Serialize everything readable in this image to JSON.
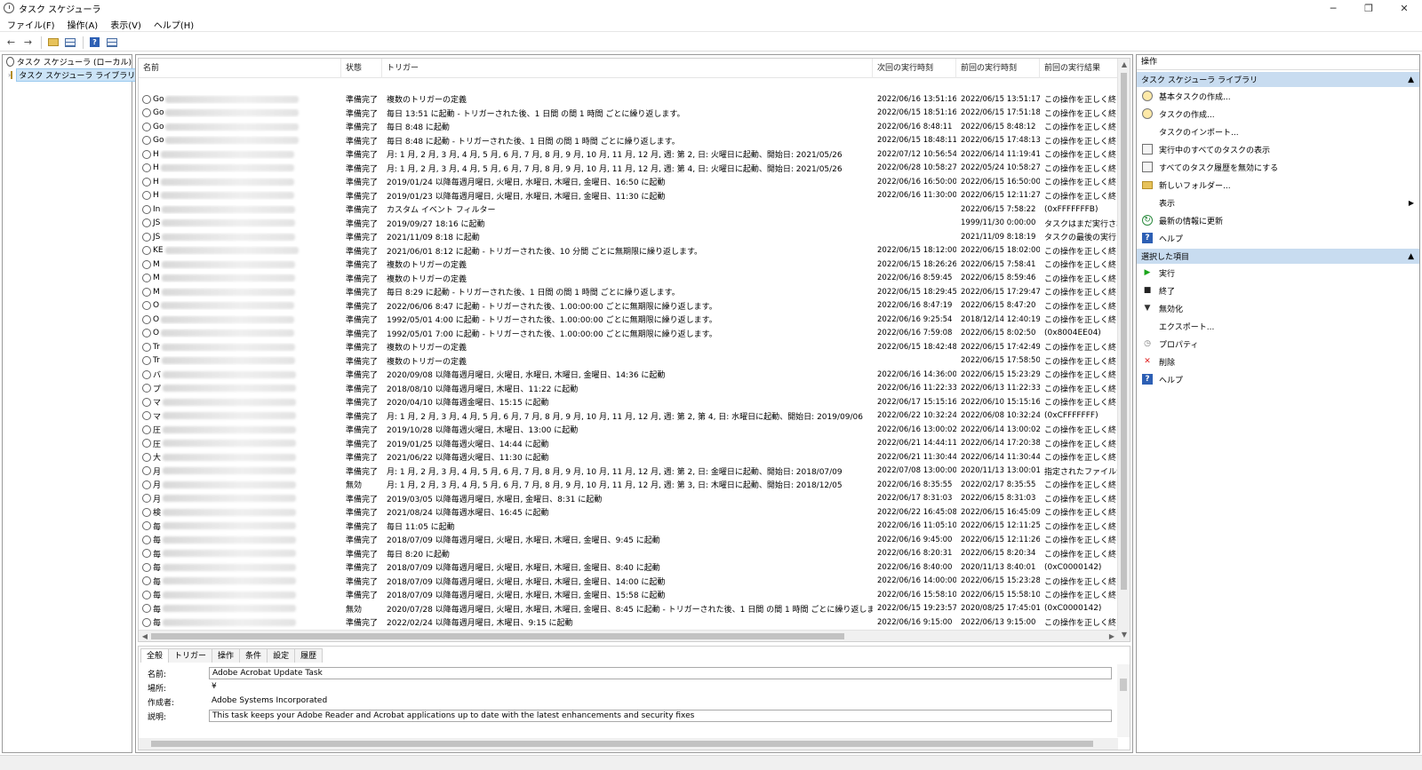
{
  "window": {
    "title": "タスク スケジューラ",
    "controls": [
      "─",
      "❐",
      "✕"
    ]
  },
  "menu": [
    "ファイル(F)",
    "操作(A)",
    "表示(V)",
    "ヘルプ(H)"
  ],
  "toolbar": {
    "back": "←",
    "forward": "→",
    "help": "?"
  },
  "tree": {
    "root_label": "タスク スケジューラ (ローカル)",
    "library_label": "タスク スケジューラ ライブラリ",
    "expander": "›"
  },
  "columns": [
    "名前",
    "状態",
    "トリガー",
    "次回の実行時刻",
    "前回の実行時刻",
    "前回の実行結果"
  ],
  "tasks": [
    {
      "name": "Go",
      "status": "準備完了",
      "trigger": "複数のトリガーの定義",
      "next": "2022/06/16 13:51:16",
      "last": "2022/06/15 13:51:17",
      "result": "この操作を正しく終了"
    },
    {
      "name": "Go",
      "status": "準備完了",
      "trigger": "毎日 13:51 に起動 - トリガーされた後、1 日間 の間 1 時間 ごとに繰り返します。",
      "next": "2022/06/15 18:51:16",
      "last": "2022/06/15 17:51:18",
      "result": "この操作を正しく終了"
    },
    {
      "name": "Go",
      "status": "準備完了",
      "trigger": "毎日 8:48 に起動",
      "next": "2022/06/16 8:48:11",
      "last": "2022/06/15 8:48:12",
      "result": "この操作を正しく終了"
    },
    {
      "name": "Go",
      "status": "準備完了",
      "trigger": "毎日 8:48 に起動 - トリガーされた後、1 日間 の間 1 時間 ごとに繰り返します。",
      "next": "2022/06/15 18:48:11",
      "last": "2022/06/15 17:48:13",
      "result": "この操作を正しく終了"
    },
    {
      "name": "H",
      "status": "準備完了",
      "trigger": "月: 1 月, 2 月, 3 月, 4 月, 5 月, 6 月, 7 月, 8 月, 9 月, 10 月, 11 月, 12 月, 週: 第 2, 日: 火曜日に起動、開始日: 2021/05/26",
      "next": "2022/07/12 10:56:54",
      "last": "2022/06/14 11:19:41",
      "result": "この操作を正しく終了"
    },
    {
      "name": "H",
      "status": "準備完了",
      "trigger": "月: 1 月, 2 月, 3 月, 4 月, 5 月, 6 月, 7 月, 8 月, 9 月, 10 月, 11 月, 12 月, 週: 第 4, 日: 火曜日に起動、開始日: 2021/05/26",
      "next": "2022/06/28 10:58:27",
      "last": "2022/05/24 10:58:27",
      "result": "この操作を正しく終了"
    },
    {
      "name": "H",
      "status": "準備完了",
      "trigger": "2019/01/24 以降毎週月曜日, 火曜日, 水曜日, 木曜日, 金曜日、16:50 に起動",
      "next": "2022/06/16 16:50:00",
      "last": "2022/06/15 16:50:00",
      "result": "この操作を正しく終了"
    },
    {
      "name": "H",
      "status": "準備完了",
      "trigger": "2019/01/23 以降毎週月曜日, 火曜日, 水曜日, 木曜日, 金曜日、11:30 に起動",
      "next": "2022/06/16 11:30:00",
      "last": "2022/06/15 12:11:27",
      "result": "この操作を正しく終了"
    },
    {
      "name": "In",
      "status": "準備完了",
      "trigger": "カスタム イベント フィルター",
      "next": "",
      "last": "2022/06/15 7:58:22",
      "result": "(0xFFFFFFFB)"
    },
    {
      "name": "JS",
      "status": "準備完了",
      "trigger": "2019/09/27 18:16 に起動",
      "next": "",
      "last": "1999/11/30 0:00:00",
      "result": "タスクはまだ実行されていません"
    },
    {
      "name": "JS",
      "status": "準備完了",
      "trigger": "2021/11/09 8:18 に起動",
      "next": "",
      "last": "2021/11/09 8:18:19",
      "result": "タスクの最後の実行"
    },
    {
      "name": "KE",
      "status": "準備完了",
      "trigger": "2021/06/01 8:12 に起動 - トリガーされた後、10 分間 ごとに無期限に繰り返します。",
      "next": "2022/06/15 18:12:00",
      "last": "2022/06/15 18:02:00",
      "result": "この操作を正しく終了"
    },
    {
      "name": "M",
      "status": "準備完了",
      "trigger": "複数のトリガーの定義",
      "next": "2022/06/15 18:26:26",
      "last": "2022/06/15 7:58:41",
      "result": "この操作を正しく終了"
    },
    {
      "name": "M",
      "status": "準備完了",
      "trigger": "複数のトリガーの定義",
      "next": "2022/06/16 8:59:45",
      "last": "2022/06/15 8:59:46",
      "result": "この操作を正しく終了"
    },
    {
      "name": "M",
      "status": "準備完了",
      "trigger": "毎日 8:29 に起動 - トリガーされた後、1 日間 の間 1 時間 ごとに繰り返します。",
      "next": "2022/06/15 18:29:45",
      "last": "2022/06/15 17:29:47",
      "result": "この操作を正しく終了"
    },
    {
      "name": "O",
      "status": "準備完了",
      "trigger": "2022/06/06 8:47 に起動 - トリガーされた後、1.00:00:00 ごとに無期限に繰り返します。",
      "next": "2022/06/16 8:47:19",
      "last": "2022/06/15 8:47:20",
      "result": "この操作を正しく終了"
    },
    {
      "name": "O",
      "status": "準備完了",
      "trigger": "1992/05/01 4:00 に起動 - トリガーされた後、1.00:00:00 ごとに無期限に繰り返します。",
      "next": "2022/06/16 9:25:54",
      "last": "2018/12/14 12:40:19",
      "result": "この操作を正しく終了"
    },
    {
      "name": "O",
      "status": "準備完了",
      "trigger": "1992/05/01 7:00 に起動 - トリガーされた後、1.00:00:00 ごとに無期限に繰り返します。",
      "next": "2022/06/16 7:59:08",
      "last": "2022/06/15 8:02:50",
      "result": "(0x8004EE04)"
    },
    {
      "name": "Tr",
      "status": "準備完了",
      "trigger": "複数のトリガーの定義",
      "next": "2022/06/15 18:42:48",
      "last": "2022/06/15 17:42:49",
      "result": "この操作を正しく終了"
    },
    {
      "name": "Tr",
      "status": "準備完了",
      "trigger": "複数のトリガーの定義",
      "next": "",
      "last": "2022/06/15 17:58:50",
      "result": "この操作を正しく終了"
    },
    {
      "name": "バ",
      "status": "準備完了",
      "trigger": "2020/09/08 以降毎週月曜日, 火曜日, 水曜日, 木曜日, 金曜日、14:36 に起動",
      "next": "2022/06/16 14:36:00",
      "last": "2022/06/15 15:23:29",
      "result": "この操作を正しく終了"
    },
    {
      "name": "プ",
      "status": "準備完了",
      "trigger": "2018/08/10 以降毎週月曜日, 木曜日、11:22 に起動",
      "next": "2022/06/16 11:22:33",
      "last": "2022/06/13 11:22:33",
      "result": "この操作を正しく終了"
    },
    {
      "name": "マ",
      "status": "準備完了",
      "trigger": "2020/04/10 以降毎週金曜日、15:15 に起動",
      "next": "2022/06/17 15:15:16",
      "last": "2022/06/10 15:15:16",
      "result": "この操作を正しく終了"
    },
    {
      "name": "マ",
      "status": "準備完了",
      "trigger": "月: 1 月, 2 月, 3 月, 4 月, 5 月, 6 月, 7 月, 8 月, 9 月, 10 月, 11 月, 12 月, 週: 第 2, 第 4, 日: 水曜日に起動、開始日: 2019/09/06",
      "next": "2022/06/22 10:32:24",
      "last": "2022/06/08 10:32:24",
      "result": "(0xCFFFFFFF)"
    },
    {
      "name": "圧",
      "status": "準備完了",
      "trigger": "2019/10/28 以降毎週火曜日, 木曜日、13:00 に起動",
      "next": "2022/06/16 13:00:02",
      "last": "2022/06/14 13:00:02",
      "result": "この操作を正しく終了"
    },
    {
      "name": "圧",
      "status": "準備完了",
      "trigger": "2019/01/25 以降毎週火曜日、14:44 に起動",
      "next": "2022/06/21 14:44:11",
      "last": "2022/06/14 17:20:38",
      "result": "この操作を正しく終了"
    },
    {
      "name": "大",
      "status": "準備完了",
      "trigger": "2021/06/22 以降毎週火曜日、11:30 に起動",
      "next": "2022/06/21 11:30:44",
      "last": "2022/06/14 11:30:44",
      "result": "この操作を正しく終了"
    },
    {
      "name": "月",
      "status": "準備完了",
      "trigger": "月: 1 月, 2 月, 3 月, 4 月, 5 月, 6 月, 7 月, 8 月, 9 月, 10 月, 11 月, 12 月, 週: 第 2, 日: 金曜日に起動、開始日: 2018/07/09",
      "next": "2022/07/08 13:00:00",
      "last": "2020/11/13 13:00:01",
      "result": "指定されたファイルが見つかりません"
    },
    {
      "name": "月",
      "status": "無効",
      "trigger": "月: 1 月, 2 月, 3 月, 4 月, 5 月, 6 月, 7 月, 8 月, 9 月, 10 月, 11 月, 12 月, 週: 第 3, 日: 木曜日に起動、開始日: 2018/12/05",
      "next": "2022/06/16 8:35:55",
      "last": "2022/02/17 8:35:55",
      "result": "この操作を正しく終了"
    },
    {
      "name": "月",
      "status": "準備完了",
      "trigger": "2019/03/05 以降毎週月曜日, 水曜日, 金曜日、8:31 に起動",
      "next": "2022/06/17 8:31:03",
      "last": "2022/06/15 8:31:03",
      "result": "この操作を正しく終了"
    },
    {
      "name": "検",
      "status": "準備完了",
      "trigger": "2021/08/24 以降毎週水曜日、16:45 に起動",
      "next": "2022/06/22 16:45:08",
      "last": "2022/06/15 16:45:09",
      "result": "この操作を正しく終了"
    },
    {
      "name": "毎",
      "status": "準備完了",
      "trigger": "毎日 11:05 に起動",
      "next": "2022/06/16 11:05:10",
      "last": "2022/06/15 12:11:25",
      "result": "この操作を正しく終了"
    },
    {
      "name": "毎",
      "status": "準備完了",
      "trigger": "2018/07/09 以降毎週月曜日, 火曜日, 水曜日, 木曜日, 金曜日、9:45 に起動",
      "next": "2022/06/16 9:45:00",
      "last": "2022/06/15 12:11:26",
      "result": "この操作を正しく終了"
    },
    {
      "name": "毎",
      "status": "準備完了",
      "trigger": "毎日 8:20 に起動",
      "next": "2022/06/16 8:20:31",
      "last": "2022/06/15 8:20:34",
      "result": "この操作を正しく終了"
    },
    {
      "name": "毎",
      "status": "準備完了",
      "trigger": "2018/07/09 以降毎週月曜日, 火曜日, 水曜日, 木曜日, 金曜日、8:40 に起動",
      "next": "2022/06/16 8:40:00",
      "last": "2020/11/13 8:40:01",
      "result": "(0xC0000142)"
    },
    {
      "name": "毎",
      "status": "準備完了",
      "trigger": "2018/07/09 以降毎週月曜日, 火曜日, 水曜日, 木曜日, 金曜日、14:00 に起動",
      "next": "2022/06/16 14:00:00",
      "last": "2022/06/15 15:23:28",
      "result": "この操作を正しく終了"
    },
    {
      "name": "毎",
      "status": "準備完了",
      "trigger": "2018/07/09 以降毎週月曜日, 火曜日, 水曜日, 木曜日, 金曜日、15:58 に起動",
      "next": "2022/06/16 15:58:10",
      "last": "2022/06/15 15:58:10",
      "result": "この操作を正しく終了"
    },
    {
      "name": "毎",
      "status": "無効",
      "trigger": "2020/07/28 以降毎週月曜日, 火曜日, 水曜日, 木曜日, 金曜日、8:45 に起動 - トリガーされた後、1 日間 の間 1 時間 ごとに繰り返します。",
      "next": "2022/06/15 19:23:57",
      "last": "2020/08/25 17:45:01",
      "result": "(0xC0000142)"
    },
    {
      "name": "毎",
      "status": "準備完了",
      "trigger": "2022/02/24 以降毎週月曜日, 木曜日、9:15 に起動",
      "next": "2022/06/16 9:15:00",
      "last": "2022/06/13 9:15:00",
      "result": "この操作を正しく終了"
    }
  ],
  "details": {
    "tabs": [
      "全般",
      "トリガー",
      "操作",
      "条件",
      "設定",
      "履歴"
    ],
    "name_label": "名前:",
    "name_value": "Adobe Acrobat Update Task",
    "location_label": "場所:",
    "location_value": "¥",
    "author_label": "作成者:",
    "author_value": "Adobe Systems Incorporated",
    "desc_label": "説明:",
    "desc_value": "This task keeps your Adobe Reader and Acrobat applications up to date with the latest enhancements and security fixes"
  },
  "actions": {
    "header": "操作",
    "section1_title": "タスク スケジューラ ライブラリ",
    "section1_items": [
      {
        "label": "基本タスクの作成...",
        "icon": "wizard-icon"
      },
      {
        "label": "タスクの作成...",
        "icon": "create-task-icon"
      },
      {
        "label": "タスクのインポート...",
        "icon": "import-icon"
      },
      {
        "label": "実行中のすべてのタスクの表示",
        "icon": "running-tasks-icon"
      },
      {
        "label": "すべてのタスク履歴を無効にする",
        "icon": "history-icon"
      },
      {
        "label": "新しいフォルダー...",
        "icon": "folder-icon"
      },
      {
        "label": "表示",
        "icon": "view-icon"
      },
      {
        "label": "最新の情報に更新",
        "icon": "refresh-icon"
      },
      {
        "label": "ヘルプ",
        "icon": "help-icon"
      }
    ],
    "section2_title": "選択した項目",
    "section2_items": [
      {
        "label": "実行",
        "icon": "run-icon"
      },
      {
        "label": "終了",
        "icon": "stop-icon"
      },
      {
        "label": "無効化",
        "icon": "disable-icon"
      },
      {
        "label": "エクスポート...",
        "icon": "export-icon"
      },
      {
        "label": "プロパティ",
        "icon": "properties-icon"
      },
      {
        "label": "削除",
        "icon": "delete-icon"
      },
      {
        "label": "ヘルプ",
        "icon": "help-icon"
      }
    ],
    "collapse": "▲",
    "submenu_arrow": "▶"
  },
  "colors": {
    "section_header": "#c8dcf0",
    "selected_tree": "#cce4f7",
    "run": "#1aa51a",
    "delete": "#e02020"
  }
}
